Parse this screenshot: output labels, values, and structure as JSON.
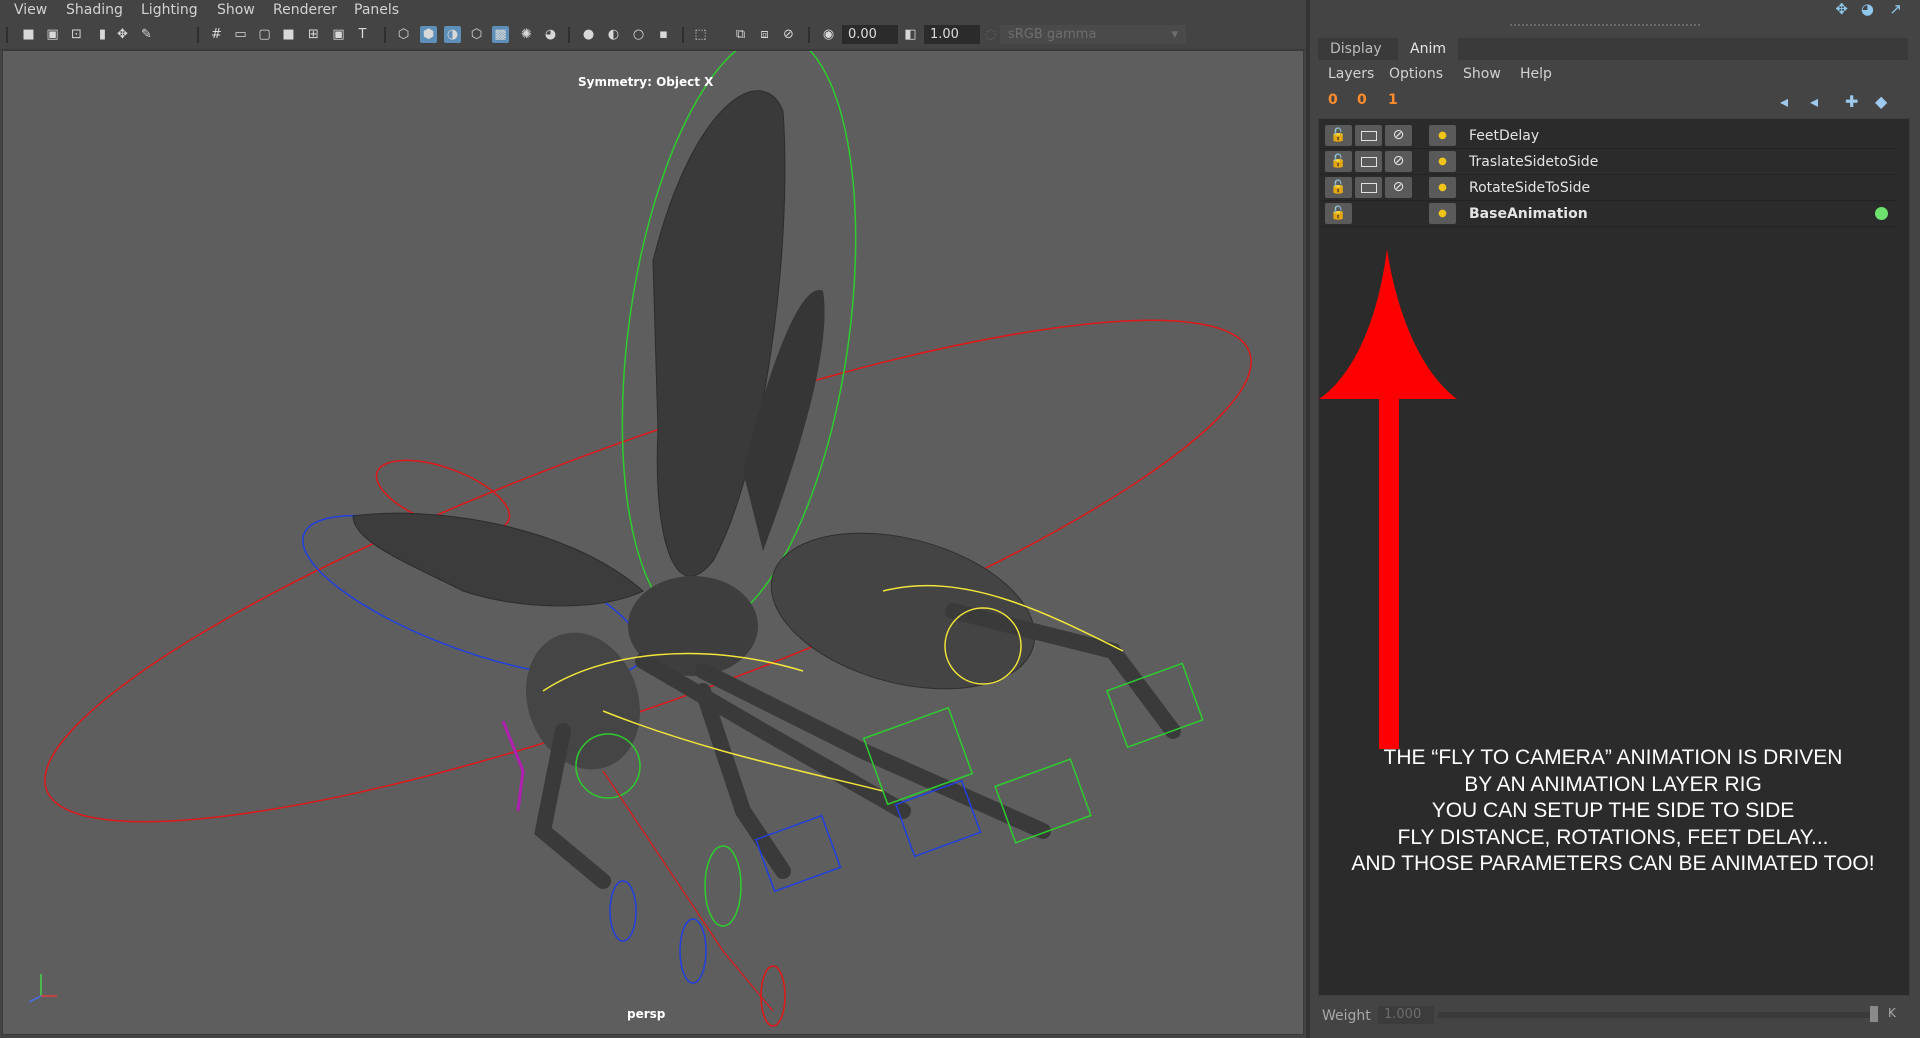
{
  "viewport": {
    "menu": [
      "View",
      "Shading",
      "Lighting",
      "Show",
      "Renderer",
      "Panels"
    ],
    "exposure": "0.00",
    "gamma": "1.00",
    "color_space": "sRGB gamma",
    "hud_symmetry": "Symmetry: Object X",
    "camera_label": "persp"
  },
  "layer_editor": {
    "tabs": [
      "Display",
      "Anim"
    ],
    "active_tab": "Anim",
    "menu": [
      "Layers",
      "Options",
      "Show",
      "Help"
    ],
    "tool_buttons": [
      "0",
      "0",
      "1"
    ],
    "layers": [
      {
        "name": "FeetDelay",
        "bold": false,
        "active": false
      },
      {
        "name": "TraslateSidetoSide",
        "bold": false,
        "active": false
      },
      {
        "name": "RotateSideToSide",
        "bold": false,
        "active": false
      },
      {
        "name": "BaseAnimation",
        "bold": true,
        "active": true
      }
    ],
    "weight_label": "Weight",
    "weight_value": "1.000",
    "key_button": "K"
  },
  "annotation": {
    "lines": [
      "THE “FLY TO CAMERA” ANIMATION IS DRIVEN",
      "BY AN ANIMATION LAYER RIG",
      "YOU CAN SETUP THE SIDE TO SIDE",
      "FLY DISTANCE, ROTATIONS, FEET DELAY...",
      "AND THOSE PARAMETERS CAN BE ANIMATED TOO!"
    ],
    "arrow_color": "#ff0000"
  },
  "colors": {
    "viewport_bg": "#5e5e5e",
    "panel_bg": "#444444",
    "active_layer_indicator": "#6ee26e",
    "lock_icon": "#f0c419"
  }
}
